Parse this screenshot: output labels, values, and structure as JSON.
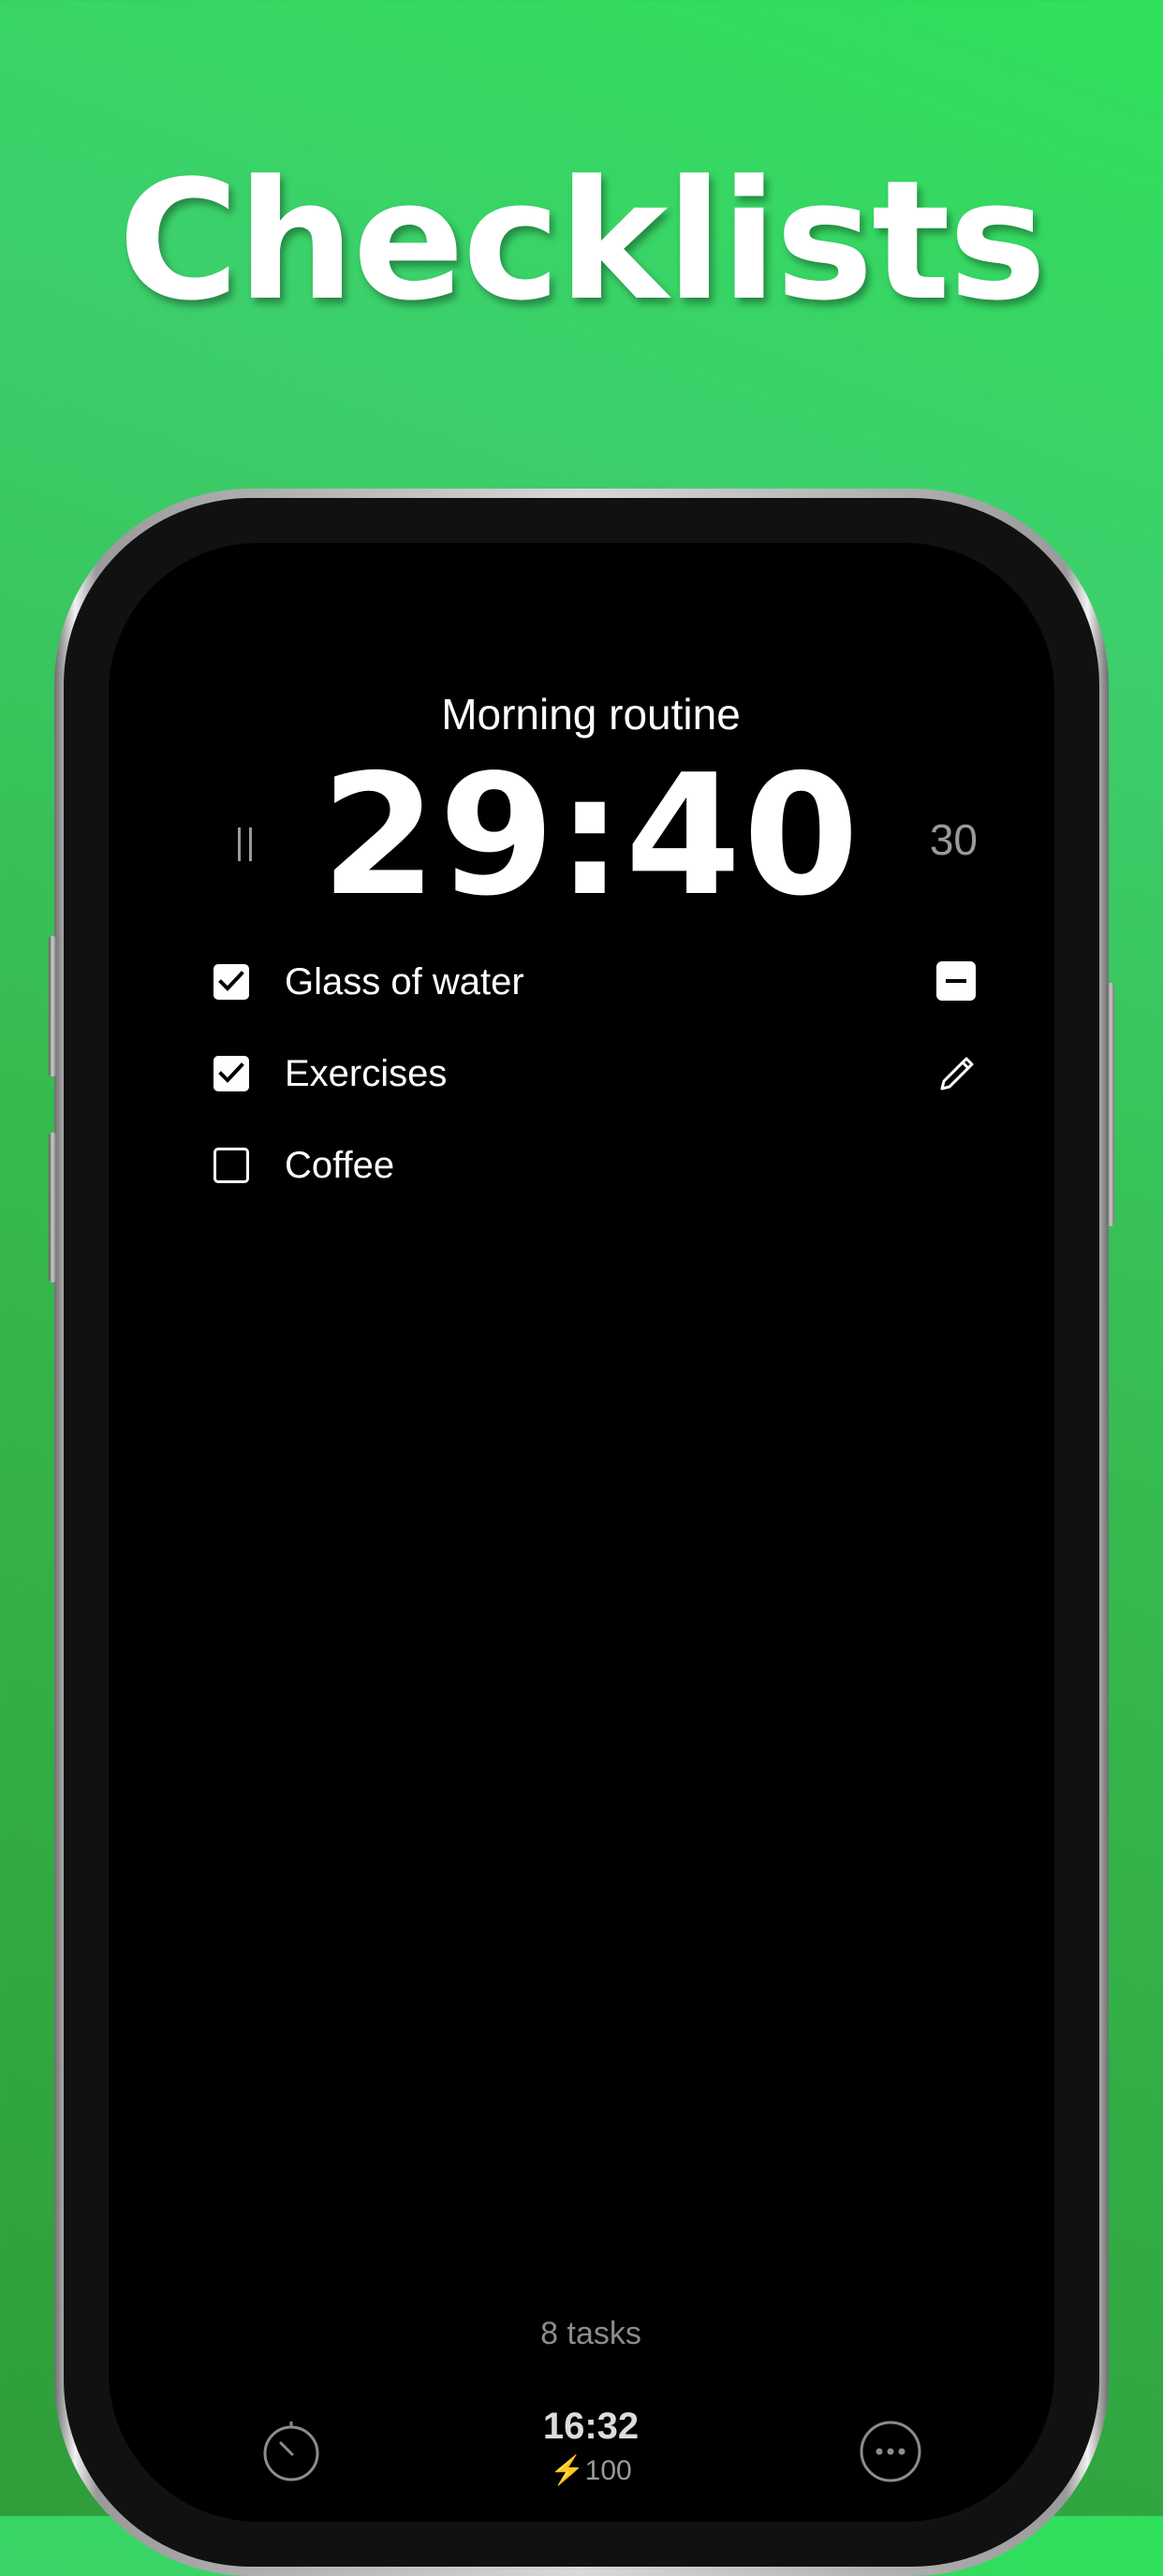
{
  "headline": "Checklists",
  "screen": {
    "routine_title": "Morning routine",
    "timer": "29:40",
    "duration_minutes": "30",
    "tasks": [
      {
        "label": "Glass of water",
        "checked": true
      },
      {
        "label": "Exercises",
        "checked": true
      },
      {
        "label": "Coffee",
        "checked": false
      }
    ],
    "task_count": "8 tasks",
    "bottom_bar": {
      "clock": "16:32",
      "battery": "⚡100"
    }
  },
  "colors": {
    "background_top": "#2fe05a",
    "background_bottom": "#2f9d3a",
    "screen": "#000000",
    "text": "#ffffff",
    "muted": "#9a9a9a"
  },
  "icons": {
    "pause": "pause-icon",
    "remove": "remove-icon",
    "edit": "pencil-icon",
    "timer": "timer-icon",
    "more": "more-icon"
  }
}
